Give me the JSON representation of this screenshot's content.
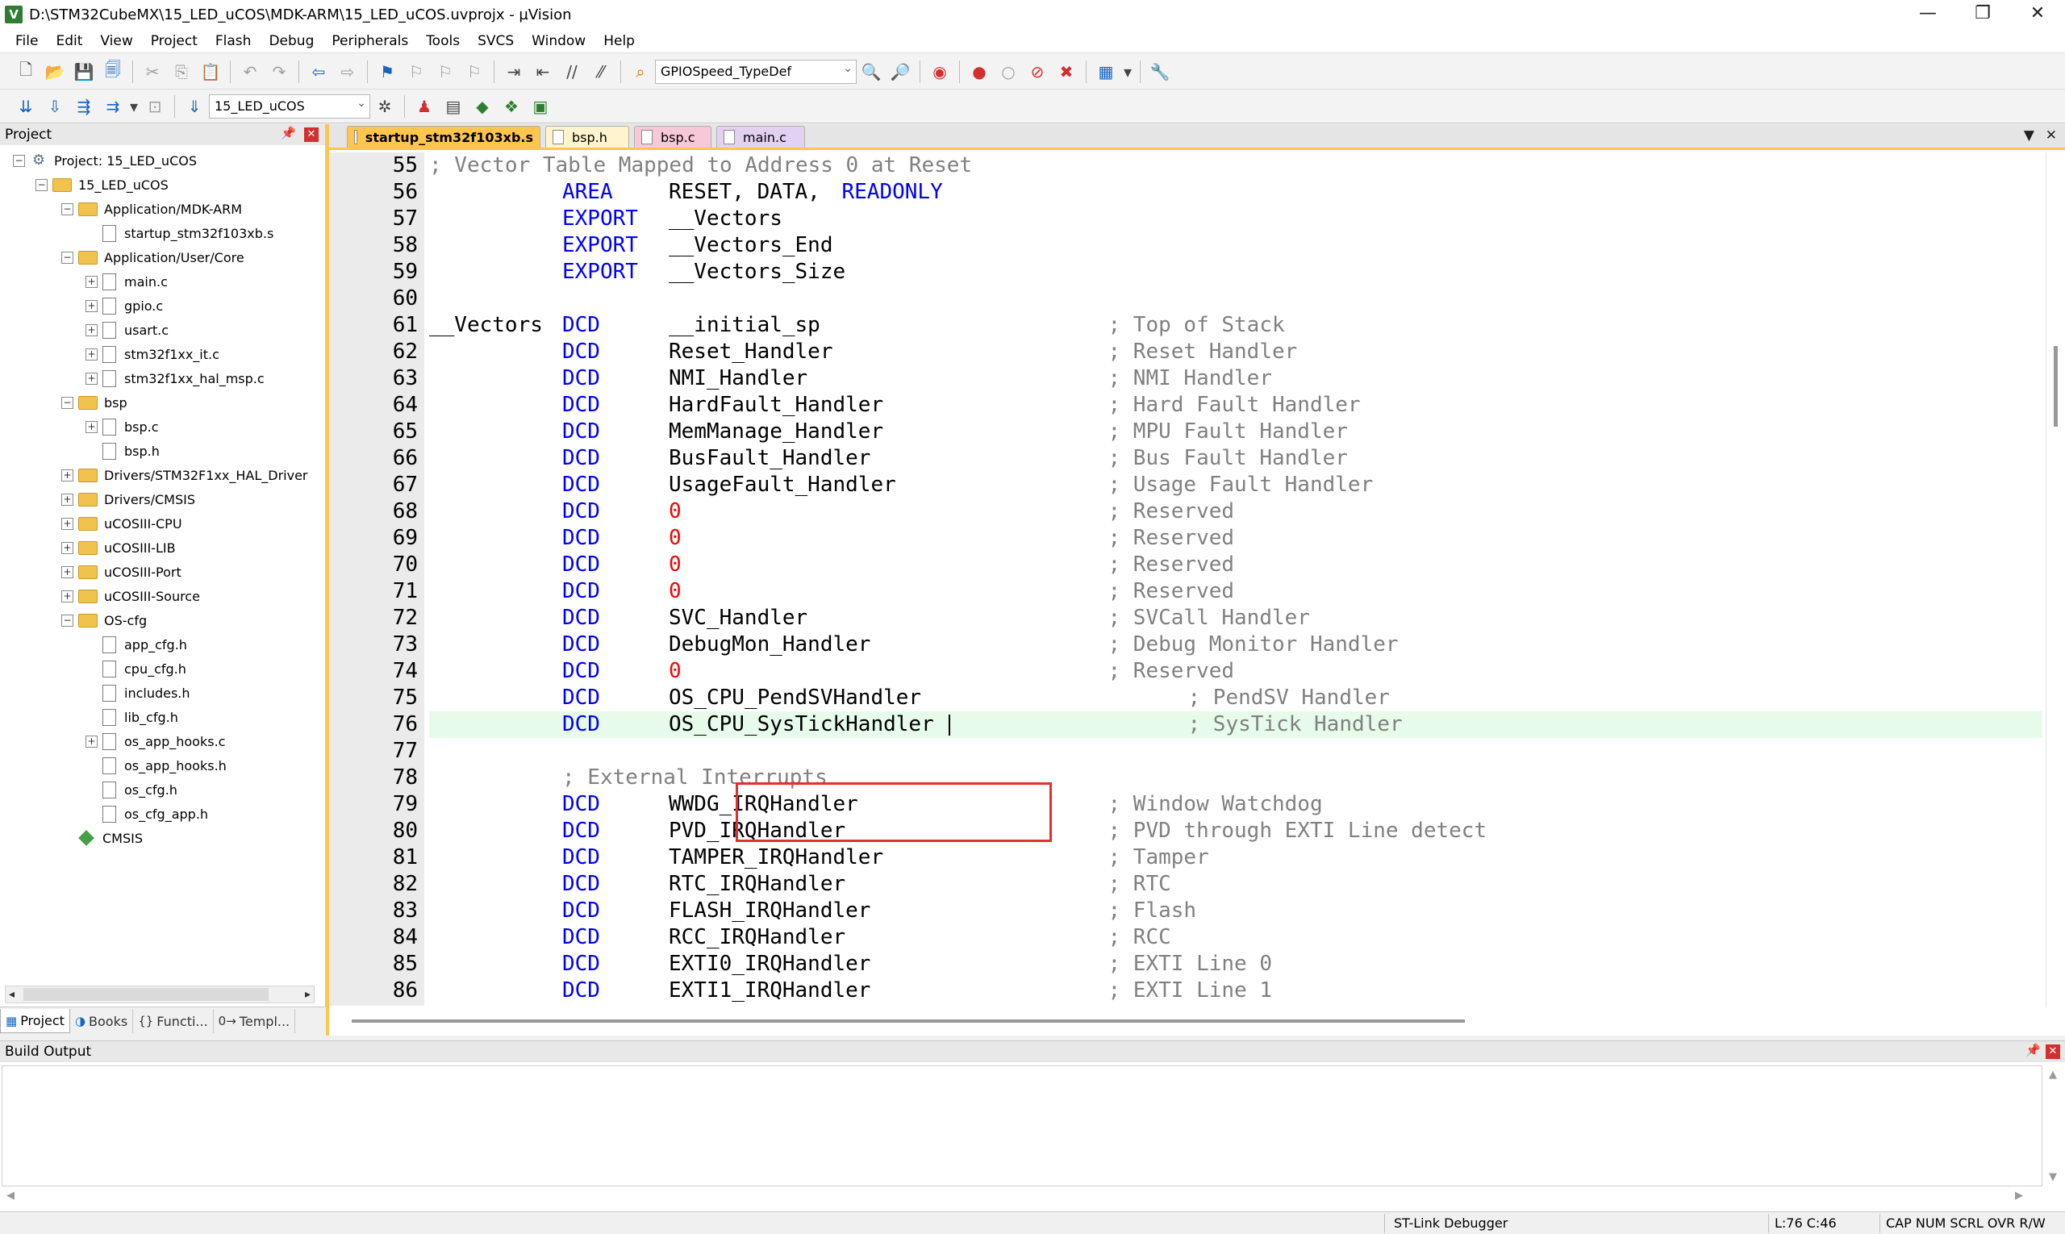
{
  "window": {
    "title": "D:\\STM32CubeMX\\15_LED_uCOS\\MDK-ARM\\15_LED_uCOS.uvprojx - µVision",
    "controls": [
      "—",
      "❐",
      "✕"
    ]
  },
  "menu": [
    "File",
    "Edit",
    "View",
    "Project",
    "Flash",
    "Debug",
    "Peripherals",
    "Tools",
    "SVCS",
    "Window",
    "Help"
  ],
  "toolbar": {
    "find_combo": "GPIOSpeed_TypeDef",
    "target_combo": "15_LED_uCOS"
  },
  "project_panel": {
    "title": "Project",
    "tree": [
      {
        "label": "Project: 15_LED_uCOS",
        "icon": "project-icon",
        "expander": "−",
        "level": 0
      },
      {
        "label": "15_LED_uCOS",
        "icon": "folder-icon",
        "expander": "−",
        "level": 1
      },
      {
        "label": "Application/MDK-ARM",
        "icon": "folder-icon",
        "expander": "−",
        "level": 2
      },
      {
        "label": "startup_stm32f103xb.s",
        "icon": "file-icon",
        "expander": "",
        "level": 3
      },
      {
        "label": "Application/User/Core",
        "icon": "folder-icon",
        "expander": "−",
        "level": 2
      },
      {
        "label": "main.c",
        "icon": "file-icon",
        "expander": "+",
        "level": 3
      },
      {
        "label": "gpio.c",
        "icon": "file-icon",
        "expander": "+",
        "level": 3
      },
      {
        "label": "usart.c",
        "icon": "file-icon",
        "expander": "+",
        "level": 3
      },
      {
        "label": "stm32f1xx_it.c",
        "icon": "file-icon",
        "expander": "+",
        "level": 3
      },
      {
        "label": "stm32f1xx_hal_msp.c",
        "icon": "file-icon",
        "expander": "+",
        "level": 3
      },
      {
        "label": "bsp",
        "icon": "folder-icon",
        "expander": "−",
        "level": 2
      },
      {
        "label": "bsp.c",
        "icon": "file-icon",
        "expander": "+",
        "level": 3
      },
      {
        "label": "bsp.h",
        "icon": "file-icon",
        "expander": "",
        "level": 3
      },
      {
        "label": "Drivers/STM32F1xx_HAL_Driver",
        "icon": "folder-icon",
        "expander": "+",
        "level": 2
      },
      {
        "label": "Drivers/CMSIS",
        "icon": "folder-icon",
        "expander": "+",
        "level": 2
      },
      {
        "label": "uCOSIII-CPU",
        "icon": "folder-icon",
        "expander": "+",
        "level": 2
      },
      {
        "label": "uCOSIII-LIB",
        "icon": "folder-icon",
        "expander": "+",
        "level": 2
      },
      {
        "label": "uCOSIII-Port",
        "icon": "folder-icon",
        "expander": "+",
        "level": 2
      },
      {
        "label": "uCOSIII-Source",
        "icon": "folder-icon",
        "expander": "+",
        "level": 2
      },
      {
        "label": "OS-cfg",
        "icon": "folder-icon",
        "expander": "−",
        "level": 2
      },
      {
        "label": "app_cfg.h",
        "icon": "file-icon",
        "expander": "",
        "level": 3
      },
      {
        "label": "cpu_cfg.h",
        "icon": "file-icon",
        "expander": "",
        "level": 3
      },
      {
        "label": "includes.h",
        "icon": "file-icon",
        "expander": "",
        "level": 3
      },
      {
        "label": "lib_cfg.h",
        "icon": "file-icon",
        "expander": "",
        "level": 3
      },
      {
        "label": "os_app_hooks.c",
        "icon": "file-icon",
        "expander": "+",
        "level": 3
      },
      {
        "label": "os_app_hooks.h",
        "icon": "file-icon",
        "expander": "",
        "level": 3
      },
      {
        "label": "os_cfg.h",
        "icon": "file-icon",
        "expander": "",
        "level": 3
      },
      {
        "label": "os_cfg_app.h",
        "icon": "file-icon",
        "expander": "",
        "level": 3
      },
      {
        "label": "CMSIS",
        "icon": "cmsis-gem-icon",
        "expander": "",
        "level": 2
      }
    ],
    "tabs": [
      {
        "label": "Project",
        "icon": "project-icon"
      },
      {
        "label": "Books",
        "icon": "books-icon"
      },
      {
        "label": "Functi...",
        "icon": "{}"
      },
      {
        "label": "Templ...",
        "icon": "0→"
      }
    ]
  },
  "editor": {
    "tabs": [
      {
        "label": "startup_stm32f103xb.s",
        "active": true
      },
      {
        "label": "bsp.h",
        "active": false
      },
      {
        "label": "bsp.c",
        "active": false
      },
      {
        "label": "main.c",
        "active": false
      }
    ],
    "lines": [
      {
        "num": "55",
        "label": "",
        "op": "",
        "operand": "",
        "comment": "; Vector Table Mapped to Address 0 at Reset",
        "comment_only": true
      },
      {
        "num": "56",
        "label": "",
        "op": "AREA",
        "operand_parts": [
          "RESET, DATA, ",
          "READONLY"
        ],
        "comment": ""
      },
      {
        "num": "57",
        "label": "",
        "op": "EXPORT",
        "operand": "__Vectors",
        "comment": ""
      },
      {
        "num": "58",
        "label": "",
        "op": "EXPORT",
        "operand": "__Vectors_End",
        "comment": ""
      },
      {
        "num": "59",
        "label": "",
        "op": "EXPORT",
        "operand": "__Vectors_Size",
        "comment": ""
      },
      {
        "num": "60",
        "label": "",
        "op": "",
        "operand": "",
        "comment": ""
      },
      {
        "num": "61",
        "label": "__Vectors",
        "op": "DCD",
        "operand": "__initial_sp",
        "comment": "; Top of Stack"
      },
      {
        "num": "62",
        "label": "",
        "op": "DCD",
        "operand": "Reset_Handler",
        "comment": "; Reset Handler"
      },
      {
        "num": "63",
        "label": "",
        "op": "DCD",
        "operand": "NMI_Handler",
        "comment": "; NMI Handler"
      },
      {
        "num": "64",
        "label": "",
        "op": "DCD",
        "operand": "HardFault_Handler",
        "comment": "; Hard Fault Handler"
      },
      {
        "num": "65",
        "label": "",
        "op": "DCD",
        "operand": "MemManage_Handler",
        "comment": "; MPU Fault Handler"
      },
      {
        "num": "66",
        "label": "",
        "op": "DCD",
        "operand": "BusFault_Handler",
        "comment": "; Bus Fault Handler"
      },
      {
        "num": "67",
        "label": "",
        "op": "DCD",
        "operand": "UsageFault_Handler",
        "comment": "; Usage Fault Handler"
      },
      {
        "num": "68",
        "label": "",
        "op": "DCD",
        "operand": "0",
        "numeric": true,
        "comment": "; Reserved"
      },
      {
        "num": "69",
        "label": "",
        "op": "DCD",
        "operand": "0",
        "numeric": true,
        "comment": "; Reserved"
      },
      {
        "num": "70",
        "label": "",
        "op": "DCD",
        "operand": "0",
        "numeric": true,
        "comment": "; Reserved"
      },
      {
        "num": "71",
        "label": "",
        "op": "DCD",
        "operand": "0",
        "numeric": true,
        "comment": "; Reserved"
      },
      {
        "num": "72",
        "label": "",
        "op": "DCD",
        "operand": "SVC_Handler",
        "comment": "; SVCall Handler"
      },
      {
        "num": "73",
        "label": "",
        "op": "DCD",
        "operand": "DebugMon_Handler",
        "comment": "; Debug Monitor Handler"
      },
      {
        "num": "74",
        "label": "",
        "op": "DCD",
        "operand": "0",
        "numeric": true,
        "comment": "; Reserved"
      },
      {
        "num": "75",
        "label": "",
        "op": "DCD",
        "operand": "OS_CPU_PendSVHandler",
        "comment": "; PendSV Handler",
        "shifted_comment": true
      },
      {
        "num": "76",
        "label": "",
        "op": "DCD",
        "operand": "OS_CPU_SysTickHandler",
        "comment": "; SysTick Handler",
        "shifted_comment": true,
        "current": true
      },
      {
        "num": "77",
        "label": "",
        "op": "",
        "operand": "",
        "comment": ""
      },
      {
        "num": "78",
        "label": "",
        "op": "",
        "operand": "",
        "comment": "; External Interrupts",
        "comment_at_op": true
      },
      {
        "num": "79",
        "label": "",
        "op": "DCD",
        "operand": "WWDG_IRQHandler",
        "comment": "; Window Watchdog"
      },
      {
        "num": "80",
        "label": "",
        "op": "DCD",
        "operand": "PVD_IRQHandler",
        "comment": "; PVD through EXTI Line detect"
      },
      {
        "num": "81",
        "label": "",
        "op": "DCD",
        "operand": "TAMPER_IRQHandler",
        "comment": "; Tamper"
      },
      {
        "num": "82",
        "label": "",
        "op": "DCD",
        "operand": "RTC_IRQHandler",
        "comment": "; RTC"
      },
      {
        "num": "83",
        "label": "",
        "op": "DCD",
        "operand": "FLASH_IRQHandler",
        "comment": "; Flash"
      },
      {
        "num": "84",
        "label": "",
        "op": "DCD",
        "operand": "RCC_IRQHandler",
        "comment": "; RCC"
      },
      {
        "num": "85",
        "label": "",
        "op": "DCD",
        "operand": "EXTI0_IRQHandler",
        "comment": "; EXTI Line 0"
      },
      {
        "num": "86",
        "label": "",
        "op": "DCD",
        "operand": "EXTI1_IRQHandler",
        "comment": "; EXTI Line 1"
      }
    ]
  },
  "build_output": {
    "title": "Build Output"
  },
  "statusbar": {
    "debugger": "ST-Link Debugger",
    "position": "L:76 C:46",
    "indicators": "CAP  NUM  SCRL  OVR  R/W"
  },
  "colors": {
    "keyword": "#0000ff",
    "comment": "#808080",
    "number": "#ff0000",
    "active_tab": "#ffc64d",
    "current_line": "#e6fbe9",
    "highlight_box": "#e03030"
  }
}
